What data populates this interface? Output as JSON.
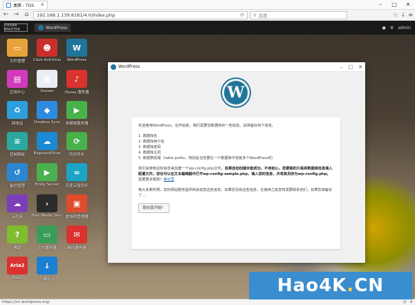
{
  "browser": {
    "tab_title": "桌面 - TOS",
    "url": "192.168.1.139:8181/4.0/index.php",
    "search_placeholder": "百度",
    "status_text": "https://cn.wordpress.org/",
    "controls": {
      "min": "–",
      "max": "□",
      "close": "✕"
    }
  },
  "tos": {
    "logo_text": "TERRA MASTER",
    "active_app": "WordPress",
    "user": "admin"
  },
  "desktop_icons": [
    {
      "label": "文件管理",
      "color": "#e8a23a",
      "glyph": "▭"
    },
    {
      "label": "Clam AntiVirus",
      "color": "#c9302c",
      "glyph": "☻"
    },
    {
      "label": "WordPress",
      "color": "#21759b",
      "glyph": "W"
    },
    {
      "label": "应用中心",
      "color": "#d13bbb",
      "glyph": "▤"
    },
    {
      "label": "Docker",
      "color": "#e8eef4",
      "glyph": "▦"
    },
    {
      "label": "iTunes 服务器",
      "color": "#d9322f",
      "glyph": "♪"
    },
    {
      "label": "回收站",
      "color": "#2c9fdc",
      "glyph": "♻"
    },
    {
      "label": "Dropbox Sync",
      "color": "#2d8ce0",
      "glyph": "◆"
    },
    {
      "label": "多媒体服务器",
      "color": "#47b24b",
      "glyph": "▶"
    },
    {
      "label": "控制面板",
      "color": "#2ba9a0",
      "glyph": "≡"
    },
    {
      "label": "ElephantDrive",
      "color": "#1b8ad2",
      "glyph": "☁"
    },
    {
      "label": "同步同步",
      "color": "#47b24b",
      "glyph": "⟳"
    },
    {
      "label": "备份管理",
      "color": "#2c86d1",
      "glyph": "↺"
    },
    {
      "label": "Emby Server",
      "color": "#4caf50",
      "glyph": "▶"
    },
    {
      "label": "百度云盘同步",
      "color": "#1ba4c6",
      "glyph": "∞"
    },
    {
      "label": "云同步",
      "color": "#7b3fb8",
      "glyph": "☁"
    },
    {
      "label": "Plex Media Server",
      "color": "#2b2b2b",
      "glyph": "›"
    },
    {
      "label": "虚拟机管理器",
      "color": "#e04b2b",
      "glyph": "▣"
    },
    {
      "label": "帮助",
      "color": "#7fbd2f",
      "glyph": "?"
    },
    {
      "label": "文件服务器",
      "color": "#3a9d57",
      "glyph": "▭"
    },
    {
      "label": "邮件服务器",
      "color": "#d9322f",
      "glyph": "✉"
    },
    {
      "label": "Aria2",
      "color": "#d9322f",
      "glyph": "Aria2"
    },
    {
      "label": "下载中心",
      "color": "#1b7fd2",
      "glyph": "↓"
    }
  ],
  "dialog": {
    "title": "WordPress",
    "logo_letter": "W",
    "intro": "欢迎使用WordPress。在开始前，我们需要您数据库的一些信息。请准备好如下信息。",
    "items": [
      "1. 数据库名",
      "2. 数据库用户名",
      "3. 数据库密码",
      "4. 数据库主机",
      "5. 数据表前缀（table prefix，特别是当您要在一个数据库中安装多个WordPress时）"
    ],
    "para2_a": "我们会使用这些信息来创建一个wp-config.php文件。",
    "para2_b": "如果自动创建未能成功，不用担心，您要做的只是将数据库信息填入配置文件。您也可以在文本编辑器中打开wp-config-sample.php，填入您的信息，并将其另存为wp-config.php。",
    "para2_c": "需要更多帮助？",
    "para2_link": "看这里",
    "para3": "绝大多数时候，您的网站服务提供商会给您这些信息。如果您没有这些信息，在继续之前您将需要联系他们。如果您准备好了…",
    "button": "现在就开始！"
  },
  "watermark": {
    "main": "Hao4K",
    "dot": ".",
    "suffix": "CN"
  }
}
